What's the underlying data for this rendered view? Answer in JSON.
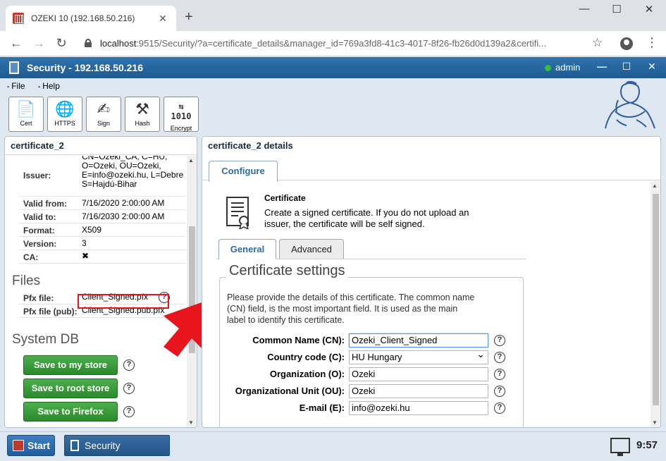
{
  "browser": {
    "tab_title": "OZEKI 10 (192.168.50.216)",
    "url_host": "localhost",
    "url_rest": ":9515/Security/?a=certificate_details&manager_id=769a3fd8-41c3-4017-8f26-fb26d0d139a2&certifi..."
  },
  "app": {
    "title": "Security - 192.168.50.216",
    "user": "admin"
  },
  "menu": {
    "file": "File",
    "help": "Help"
  },
  "toolbar": [
    {
      "label": "Cert",
      "icon": "cert-icon"
    },
    {
      "label": "HTTPS",
      "icon": "globe-icon"
    },
    {
      "label": "Sign",
      "icon": "sign-icon"
    },
    {
      "label": "Hash",
      "icon": "hammer-icon"
    },
    {
      "label": "Encrypt",
      "icon": "binary-icon"
    }
  ],
  "left": {
    "header": "certificate_2",
    "issuer_label": "Issuer:",
    "issuer_lines": [
      "CN=Ozeki_CA, C=HU,",
      "O=Ozeki, OU=Ozeki,",
      "E=info@ozeki.hu, L=Debre",
      "S=Hajdú-Bihar"
    ],
    "valid_from_label": "Valid from:",
    "valid_from": "7/16/2020 2:00:00 AM",
    "valid_to_label": "Valid to:",
    "valid_to": "7/16/2030 2:00:00 AM",
    "format_label": "Format:",
    "format": "X509",
    "version_label": "Version:",
    "version": "3",
    "ca_label": "CA:",
    "ca_value": "✖",
    "files_title": "Files",
    "pfx_label": "Pfx file:",
    "pfx_link": "Client_Signed.pfx",
    "pfxpub_label": "Pfx file (pub):",
    "pfxpub_link": "Client_Signed.pub.pfx",
    "systemdb_title": "System DB",
    "btn_my_store": "Save to my store",
    "btn_root_store": "Save to root store",
    "btn_firefox": "Save to Firefox"
  },
  "right": {
    "header": "certificate_2 details",
    "tab_configure": "Configure",
    "cert_title": "Certificate",
    "cert_desc": "Create a signed certificate. If you do not upload an issuer, the certificate will be self signed.",
    "tab_general": "General",
    "tab_advanced": "Advanced",
    "settings_title": "Certificate settings",
    "settings_desc": "Please provide the details of this certificate. The common name (CN) field, is the most important field. It is used as the main label to identify this certificate.",
    "fields": [
      {
        "label": "Common Name (CN):",
        "value": "Ozeki_Client_Signed"
      },
      {
        "label": "Country code (C):",
        "value": "HU Hungary"
      },
      {
        "label": "Organization (O):",
        "value": "Ozeki"
      },
      {
        "label": "Organizational Unit (OU):",
        "value": "Ozeki"
      },
      {
        "label": "E-mail (E):",
        "value": "info@ozeki.hu"
      }
    ]
  },
  "taskbar": {
    "start": "Start",
    "app": "Security",
    "clock": "9:57"
  },
  "help_glyph": "?"
}
